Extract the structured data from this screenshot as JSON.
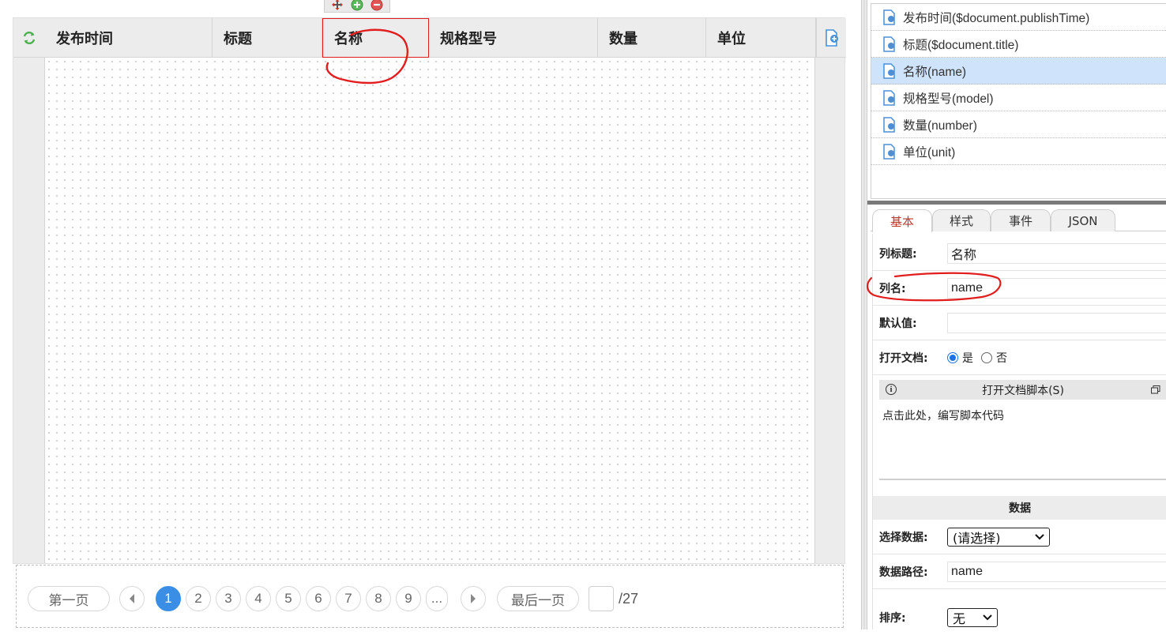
{
  "view": {
    "columns": [
      {
        "label": "发布时间"
      },
      {
        "label": "标题"
      },
      {
        "label": "名称"
      },
      {
        "label": "规格型号"
      },
      {
        "label": "数量"
      },
      {
        "label": "单位"
      }
    ],
    "selected_column": 2
  },
  "pager": {
    "first": "第一页",
    "pages": [
      "1",
      "2",
      "3",
      "4",
      "5",
      "6",
      "7",
      "8",
      "9",
      "..."
    ],
    "current": "1",
    "last": "最后一页",
    "total": "/27"
  },
  "fields": [
    {
      "label": "发布时间($document.publishTime)"
    },
    {
      "label": "标题($document.title)"
    },
    {
      "label": "名称(name)",
      "selected": true
    },
    {
      "label": "规格型号(model)"
    },
    {
      "label": "数量(number)"
    },
    {
      "label": "单位(unit)"
    }
  ],
  "tabs": [
    "基本",
    "样式",
    "事件",
    "JSON"
  ],
  "props": {
    "col_title_label": "列标题:",
    "col_title_value": "名称",
    "col_name_label": "列名:",
    "col_name_value": "name",
    "default_label": "默认值:",
    "default_value": "",
    "open_doc_label": "打开文档:",
    "yes": "是",
    "no": "否",
    "script_title": "打开文档脚本(S)",
    "script_placeholder": "点击此处，编写脚本代码",
    "data_section": "数据",
    "select_data_label": "选择数据:",
    "select_data_value": "(请选择)",
    "data_path_label": "数据路径:",
    "data_path_value": "name",
    "sort_label": "排序:",
    "sort_value": "无"
  },
  "colors": {
    "accent": "#3b8ee6",
    "selection": "#cfe3fb",
    "annotation": "#e11d1d",
    "active_tab": "#c0392b"
  }
}
